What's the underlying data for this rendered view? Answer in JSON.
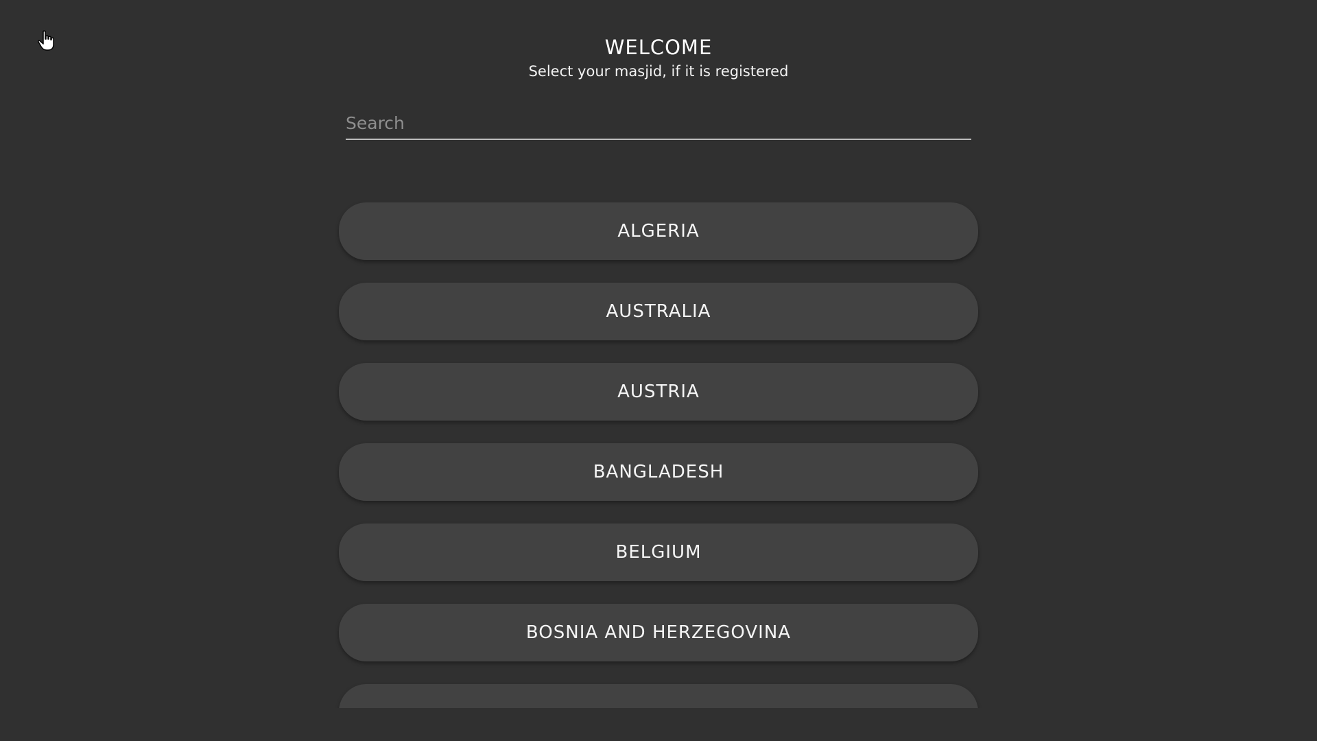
{
  "header": {
    "title": "WELCOME",
    "subtitle": "Select your masjid, if it is registered"
  },
  "search": {
    "placeholder": "Search",
    "value": ""
  },
  "countries": [
    {
      "label": "ALGERIA"
    },
    {
      "label": "AUSTRALIA"
    },
    {
      "label": "AUSTRIA"
    },
    {
      "label": "BANGLADESH"
    },
    {
      "label": "BELGIUM"
    },
    {
      "label": "BOSNIA AND HERZEGOVINA"
    },
    {
      "label": ""
    }
  ],
  "cursor": {
    "icon": "hand-pointer-icon"
  },
  "colors": {
    "background": "#303030",
    "button": "#424242",
    "text": "#ffffff",
    "placeholder": "#8e8e8e",
    "underline": "#bdbdbd"
  }
}
